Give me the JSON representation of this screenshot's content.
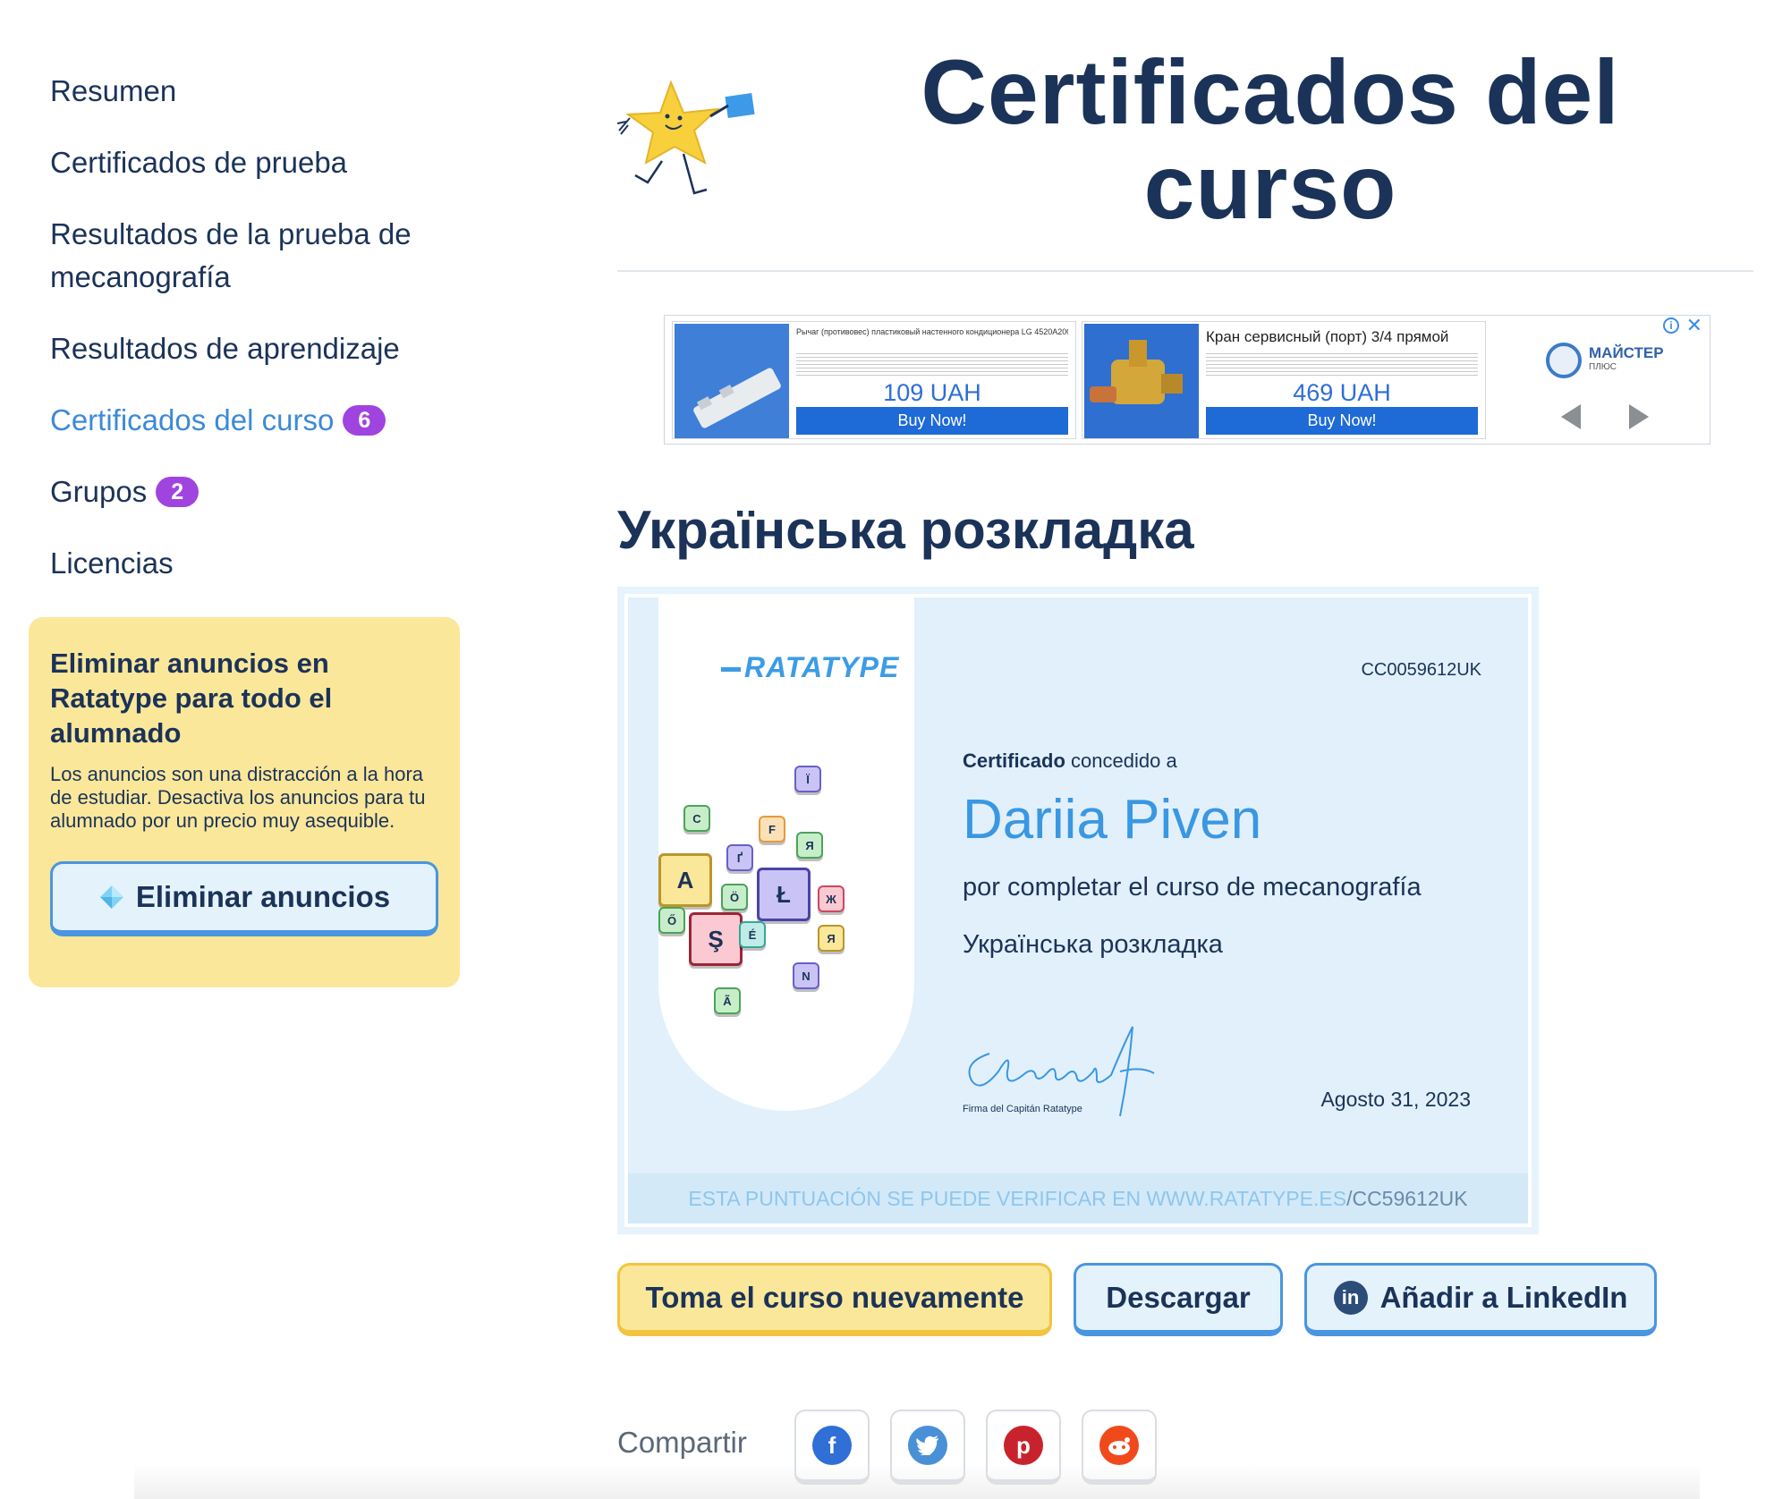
{
  "sidebar": {
    "items": [
      {
        "label": "Resumen"
      },
      {
        "label": "Certificados de prueba"
      },
      {
        "label": "Resultados de la prueba de mecanografía"
      },
      {
        "label": "Resultados de aprendizaje"
      },
      {
        "label": "Certificados del curso",
        "badge": "6"
      },
      {
        "label": "Grupos",
        "badge": "2"
      },
      {
        "label": "Licencias"
      }
    ],
    "promo": {
      "title": "Eliminar anuncios en Ratatype para todo el alumnado",
      "text": "Los anuncios son una distracción a la hora de estudiar. Desactiva los anuncios para tu alumnado por un precio muy asequible.",
      "button": "Eliminar anuncios",
      "button_icon": "diamond-icon"
    }
  },
  "header": {
    "title": "Certificados del curso",
    "mascot_icon": "star-mascot-icon"
  },
  "ad": {
    "cards": [
      {
        "description": "Рычаг (противовес) пластиковый настенного кондиционера LG 4520A20049A",
        "price": "109 UAH",
        "button": "Buy Now!"
      },
      {
        "description": "Кран сервисный (порт) 3/4 прямой",
        "price": "469 UAH",
        "button": "Buy Now!"
      }
    ],
    "brand": {
      "name": "МАЙСТЕР",
      "sub": "ПЛЮС"
    },
    "info_icon": "info-icon",
    "close_icon": "close-icon"
  },
  "course": {
    "title": "Українська розкладка"
  },
  "certificate": {
    "logo": "RATATYPE",
    "code": "CC0059612UK",
    "awarded_bold": "Certificado",
    "awarded_rest": " concedido a",
    "name": "Dariia Piven",
    "for_text": "por completar el curso de mecanografía",
    "course": "Українська розкладка",
    "signature_label": "Firma del Capitán Ratatype",
    "date": "Agosto 31, 2023",
    "verify_prefix": "ESTA PUNTUACIÓN SE PUEDE VERIFICAR EN WWW.RATATYPE.ES",
    "verify_suffix": "/CC59612UK",
    "keys": [
      {
        "char": "Ї",
        "color": "#c9c4f5",
        "border": "#6a5fc9"
      },
      {
        "char": "C",
        "color": "#c8edc9",
        "border": "#4aa35a"
      },
      {
        "char": "F",
        "color": "#fce0b7",
        "border": "#e59a3c"
      },
      {
        "char": "Я",
        "color": "#c8edc9",
        "border": "#4aa35a"
      },
      {
        "char": "A",
        "color": "#fbe79a",
        "border": "#b9962a"
      },
      {
        "char": "Ґ",
        "color": "#c9c4f5",
        "border": "#6a5fc9"
      },
      {
        "char": "Ł",
        "color": "#c9c4f5",
        "border": "#4b43a8"
      },
      {
        "char": "Ö",
        "color": "#c8edc9",
        "border": "#4aa35a"
      },
      {
        "char": "Ж",
        "color": "#fbc9d2",
        "border": "#c9485e"
      },
      {
        "char": "Ő",
        "color": "#c8edc9",
        "border": "#4aa35a"
      },
      {
        "char": "Ş",
        "color": "#fbc9d2",
        "border": "#9c2638"
      },
      {
        "char": "É",
        "color": "#bfece6",
        "border": "#3aa597"
      },
      {
        "char": "Я",
        "color": "#fbe79a",
        "border": "#b9962a"
      },
      {
        "char": "N",
        "color": "#c9c4f5",
        "border": "#6a5fc9"
      },
      {
        "char": "Ã",
        "color": "#c8edc9",
        "border": "#4aa35a"
      }
    ]
  },
  "actions": {
    "retake": "Toma el curso nuevamente",
    "download": "Descargar",
    "linkedin": "Añadir a LinkedIn"
  },
  "share": {
    "label": "Compartir",
    "networks": [
      {
        "name": "facebook-icon",
        "color": "#2f6fd6"
      },
      {
        "name": "twitter-icon",
        "color": "#4a90d6"
      },
      {
        "name": "pinterest-icon",
        "color": "#c8232c"
      },
      {
        "name": "reddit-icon",
        "color": "#f04a1c"
      }
    ]
  }
}
